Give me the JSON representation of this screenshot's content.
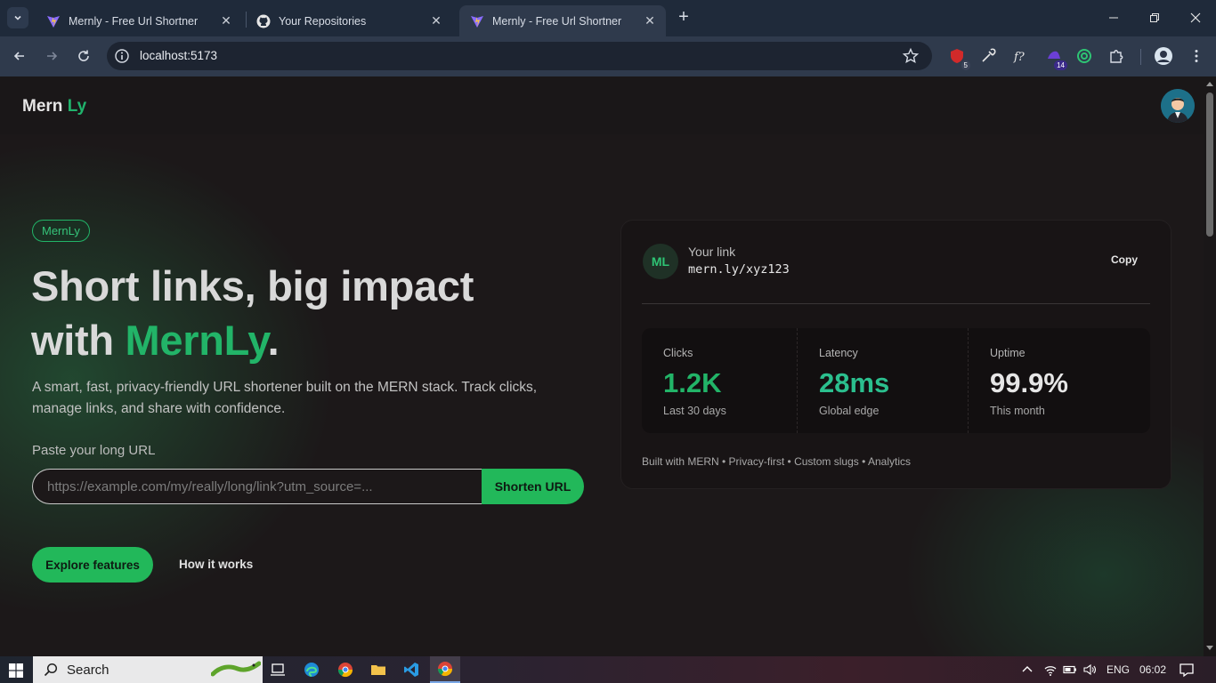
{
  "browser": {
    "tabs": [
      {
        "title": "Mernly - Free Url Shortner",
        "active": false,
        "favicon": "vite-logo"
      },
      {
        "title": "Your Repositories",
        "active": false,
        "favicon": "github-logo"
      },
      {
        "title": "Mernly - Free Url Shortner",
        "active": true,
        "favicon": "vite-logo"
      }
    ],
    "url": "localhost:5173",
    "extension_badges": {
      "ext1": "5",
      "ext2": "14"
    }
  },
  "page": {
    "brand": {
      "part1": "Mern",
      "part2": "Ly"
    },
    "pill": "MernLy",
    "headline": {
      "line1": "Short links, big impact",
      "line2_prefix": "with ",
      "line2_green": "MernLy",
      "line2_suffix": "."
    },
    "subtext": "A smart, fast, privacy-friendly URL shortener built on the MERN stack. Track clicks, manage links, and share with confidence.",
    "input_label": "Paste your long URL",
    "input_placeholder": "https://example.com/my/really/long/link?utm_source=...",
    "shorten_label": "Shorten URL",
    "explore_label": "Explore features",
    "how_label": "How it works",
    "card": {
      "badge": "ML",
      "your_link_label": "Your link",
      "link_value": "mern.ly/xyz123",
      "copy_label": "Copy",
      "stats": [
        {
          "label": "Clicks",
          "value": "1.2K",
          "sub": "Last 30 days",
          "color": "#22b468"
        },
        {
          "label": "Latency",
          "value": "28ms",
          "sub": "Global edge",
          "color": "#2bbf8e"
        },
        {
          "label": "Uptime",
          "value": "99.9%",
          "sub": "This month",
          "color": "#e6e6e6"
        }
      ],
      "footer": "Built with MERN • Privacy-first • Custom slugs • Analytics"
    }
  },
  "taskbar": {
    "search_label": "Search",
    "lang": "ENG",
    "time": "06:02"
  },
  "colors": {
    "accent": "#22b468",
    "background": "#1c1819"
  }
}
